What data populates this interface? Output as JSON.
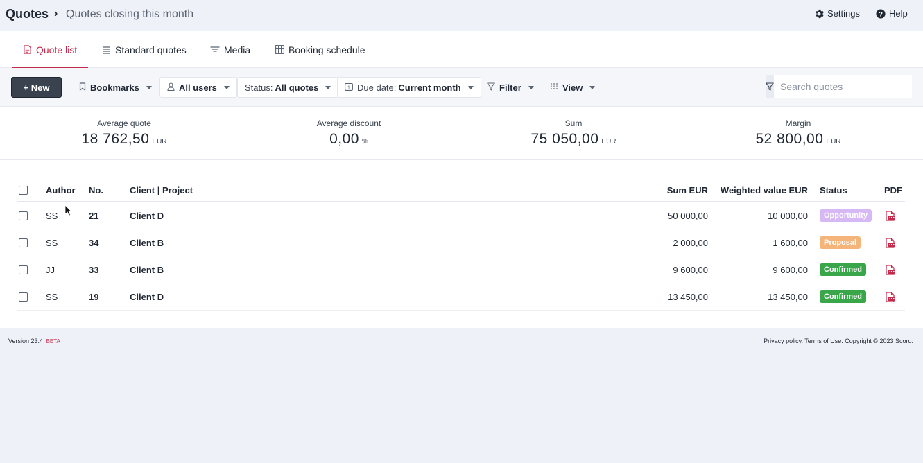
{
  "breadcrumb": {
    "main": "Quotes",
    "separator": "›",
    "sub": "Quotes closing this month"
  },
  "top_links": {
    "settings": "Settings",
    "help": "Help"
  },
  "tabs": [
    {
      "label": "Quote list",
      "icon": "quote-list-icon",
      "active": true
    },
    {
      "label": "Standard quotes",
      "icon": "list-icon",
      "active": false
    },
    {
      "label": "Media",
      "icon": "media-icon",
      "active": false
    },
    {
      "label": "Booking schedule",
      "icon": "grid-icon",
      "active": false
    }
  ],
  "toolbar": {
    "new_label": "+ New",
    "bookmarks_label": "Bookmarks",
    "users_label": "All users",
    "status_prefix": "Status:",
    "status_value": "All quotes",
    "due_prefix": "Due date:",
    "due_value": "Current month",
    "filter_label": "Filter",
    "view_label": "View",
    "search_placeholder": "Search quotes"
  },
  "stats": [
    {
      "label": "Average quote",
      "value": "18 762,50",
      "unit": "EUR"
    },
    {
      "label": "Average discount",
      "value": "0,00",
      "unit": "%"
    },
    {
      "label": "Sum",
      "value": "75 050,00",
      "unit": "EUR"
    },
    {
      "label": "Margin",
      "value": "52 800,00",
      "unit": "EUR"
    }
  ],
  "table": {
    "headers": {
      "author": "Author",
      "no": "No.",
      "client": "Client | Project",
      "sum": "Sum EUR",
      "weighted": "Weighted value EUR",
      "status": "Status",
      "pdf": "PDF"
    },
    "rows": [
      {
        "author": "SS",
        "no": "21",
        "client": "Client D",
        "sum": "50 000,00",
        "weighted": "10 000,00",
        "status": "Opportunity",
        "status_color": "#d6b8f5"
      },
      {
        "author": "SS",
        "no": "34",
        "client": "Client B",
        "sum": "2 000,00",
        "weighted": "1 600,00",
        "status": "Proposal",
        "status_color": "#f4b47a"
      },
      {
        "author": "JJ",
        "no": "33",
        "client": "Client B",
        "sum": "9 600,00",
        "weighted": "9 600,00",
        "status": "Confirmed",
        "status_color": "#3aa64a"
      },
      {
        "author": "SS",
        "no": "19",
        "client": "Client D",
        "sum": "13 450,00",
        "weighted": "13 450,00",
        "status": "Confirmed",
        "status_color": "#3aa64a"
      }
    ]
  },
  "footer": {
    "version": "Version 23.4",
    "beta": "BETA",
    "legal": "Privacy policy. Terms of Use. Copyright © 2023 Scoro."
  },
  "colors": {
    "accent": "#c62a4a",
    "primary_button": "#3a4250",
    "background": "#eef1f8"
  }
}
